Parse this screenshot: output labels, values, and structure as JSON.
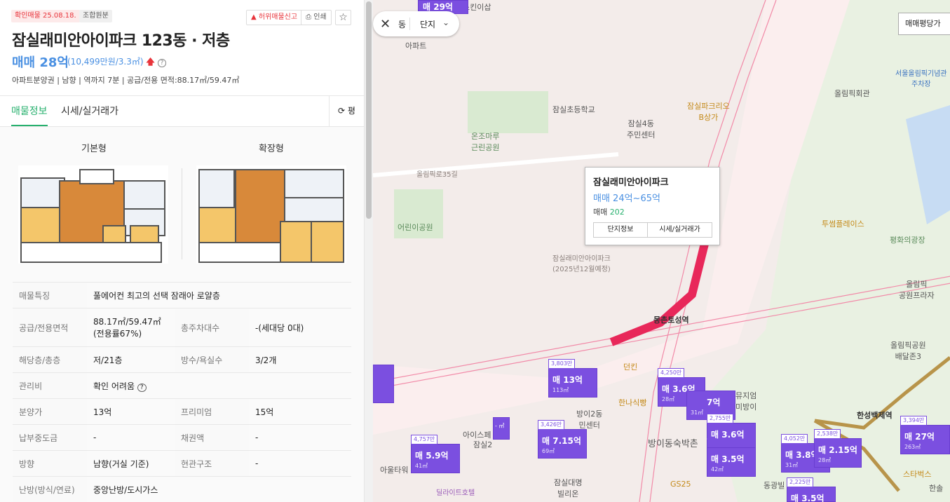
{
  "header": {
    "confirm_tag": "확인매물 25.08.18.",
    "source_tag": "조합원분",
    "report_button": "허위매물신고",
    "print_button": "인쇄",
    "title": "잠실래미안아이파크 123동 · 저층",
    "price": "매매 28억",
    "price_sub": "(10,499만원/3.3㎡)",
    "summary": "아파트분양권 | 남향 | 역까지 7분 | 공급/전용 면적:88.17㎡/59.47㎡"
  },
  "tabs": {
    "info": "매물정보",
    "market": "시세/실거래가",
    "unit": "평"
  },
  "floorplans": {
    "basic": "기본형",
    "extended": "확장형"
  },
  "details": [
    {
      "k": "매물특징",
      "v": "풀에어컨 최고의 선택 잠래아 로얄층"
    },
    {
      "k": "공급/전용면적",
      "v": "88.17㎡/59.47㎡(전용률67%)",
      "k2": "총주차대수",
      "v2": "-(세대당 0대)"
    },
    {
      "k": "해당층/총층",
      "v": "저/21층",
      "k2": "방수/욕실수",
      "v2": "3/2개"
    },
    {
      "k": "관리비",
      "v": "확인 어려움"
    },
    {
      "k": "분양가",
      "v": "13억",
      "k2": "프리미엄",
      "v2": "15억"
    },
    {
      "k": "납부중도금",
      "v": "-",
      "k2": "채권액",
      "v2": "-"
    },
    {
      "k": "방향",
      "v": "남향(거실 기준)",
      "k2": "현관구조",
      "v2": "-"
    },
    {
      "k": "난방(방식/연료)",
      "v": "중앙난방/도시가스"
    }
  ],
  "map": {
    "search_partial": "동",
    "search_filter": "단지",
    "price_toggle": "매매평당가",
    "top_marker": "매 29억",
    "labels": {
      "skincare": "스킨이삽",
      "apt": "아파트",
      "school": "잠실초등학교",
      "jamsil4": "잠실4동\n주민센터",
      "park_b": "잠실파크리오\nB상가",
      "onjo": "온조마루\n근린공원",
      "olympic35": "올림픽로35길",
      "kids_park": "어린이공원",
      "jamsil_mia": "잠실래미안아이파크\n(2025년12월예정)",
      "mongchon": "몽촌토성역",
      "olympic_hall": "올림픽회관",
      "olympic_parking": "서울올림픽기념관\n주차장",
      "twosome": "투썸플레이스",
      "peace": "평화의광장",
      "olympic_plaza": "올림픽\n공원프라자",
      "baedal": "올림픽공원\n배달존3",
      "dunkin": "던킨",
      "hanacil": "한나식빵",
      "bangi2": "방이2동\n민센터",
      "bangi_village": "방이동숙박촌",
      "hansung": "한성백제역",
      "ice": "아이스페",
      "jamsil2": "잠실2",
      "alwater": "아울타워",
      "delight": "딜라이트호텔",
      "jamsil_villa": "잠실대명\n빌리온",
      "gs25": "GS25",
      "starbucks": "스타벅스",
      "dongkwang": "동광빌",
      "musicum": "뮤지엄\n미방이",
      "hansu": "한솔"
    },
    "popup": {
      "title": "잠실래미안아이파크",
      "price_range": "매매 24억~65억",
      "count_label": "매매",
      "count": "202",
      "btn_info": "단지정보",
      "btn_market": "시세/실거래가"
    },
    "markers": [
      {
        "count": "3,803만",
        "price": "매 13억",
        "area": "113㎡"
      },
      {
        "count": "4,250만",
        "price": "매 3.6억",
        "area": "28㎡"
      },
      {
        "count": "",
        "price": "7억",
        "area": "31㎡"
      },
      {
        "count": "3,426만",
        "price": "매 7.15억",
        "area": "69㎡"
      },
      {
        "count": "4,757만",
        "price": "매 5.9억",
        "area": "41㎡"
      },
      {
        "count": "2,755만",
        "price": "매 3.6억",
        "area": ""
      },
      {
        "count": "",
        "price": "매 3.5억",
        "area": "42㎡"
      },
      {
        "count": "4,052만",
        "price": "매 3.8억",
        "area": "31㎡"
      },
      {
        "count": "2,538만",
        "price": "매 2.15억",
        "area": "28㎡"
      },
      {
        "count": "3,394만",
        "price": "매 27억",
        "area": "263㎡"
      },
      {
        "count": "2,225만",
        "price": "매 3.5억",
        "area": ""
      }
    ]
  }
}
